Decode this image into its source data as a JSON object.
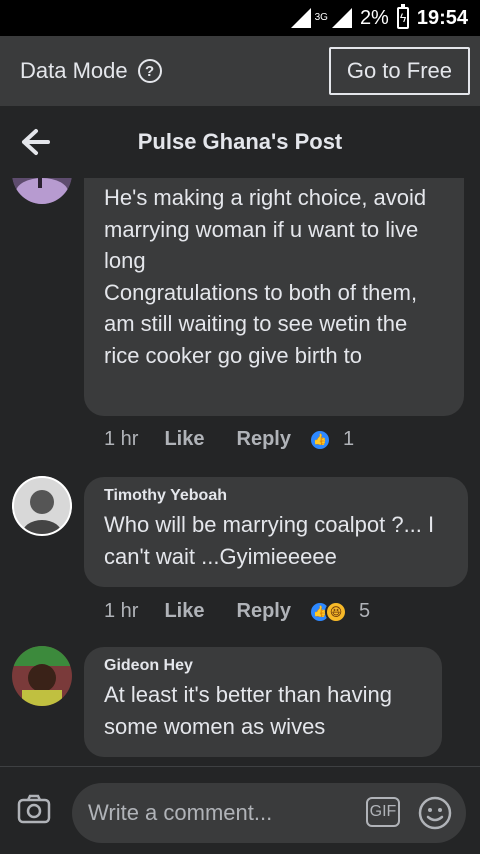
{
  "status_bar": {
    "network": "3G",
    "battery": "2%",
    "time": "19:54"
  },
  "data_mode": {
    "label": "Data Mode",
    "help_icon": "?",
    "button": "Go to Free"
  },
  "header": {
    "title": "Pulse Ghana's Post",
    "back_icon": "arrow-left-icon"
  },
  "comments": [
    {
      "name": "",
      "text": "He's making a right choice, avoid marrying woman if u want to live long\nCongratulations to both of them, am still waiting to see wetin the rice cooker go give birth to",
      "time": "1 hr",
      "like": "Like",
      "reply": "Reply",
      "reactions": [
        "like"
      ],
      "reaction_count": "1"
    },
    {
      "name": "Timothy Yeboah",
      "text": "Who will be marrying coalpot ?... I can't wait ...Gyimieeeee",
      "time": "1 hr",
      "like": "Like",
      "reply": "Reply",
      "reactions": [
        "like",
        "haha"
      ],
      "reaction_count": "5"
    },
    {
      "name": "Gideon Hey",
      "text": "At least it's better than having some women as wives"
    }
  ],
  "composer": {
    "placeholder": "Write a comment...",
    "gif": "GIF"
  },
  "colors": {
    "background": "#18191a",
    "surface": "#242526",
    "bubble": "#3a3b3c",
    "accent": "#2d88ff"
  }
}
